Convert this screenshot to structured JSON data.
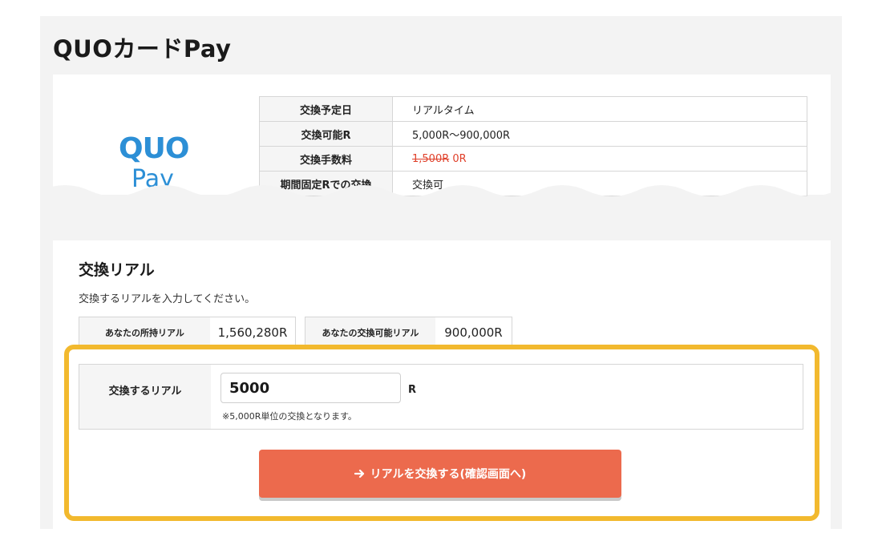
{
  "page": {
    "title": "QUOカードPay"
  },
  "logo": {
    "top_text": "QUO",
    "bottom_text": "Pay",
    "color": "#2c8fd6"
  },
  "info_table": {
    "rows": [
      {
        "label": "交換予定日",
        "value": "リアルタイム"
      },
      {
        "label": "交換可能R",
        "value": "5,000R～900,000R"
      },
      {
        "label": "交換手数料",
        "value_old": "1,500R",
        "value_new": "0R"
      },
      {
        "label": "期間固定Rでの交換",
        "value": "交換可"
      }
    ]
  },
  "exchange": {
    "section_title": "交換リアル",
    "instruction": "交換するリアルを入力してください。",
    "owned_label": "あなたの所持リアル",
    "owned_value": "1,560,280R",
    "exchangeable_label": "あなたの交換可能リアル",
    "exchangeable_value": "900,000R",
    "input_label": "交換するリアル",
    "input_value": "5000",
    "unit": "R",
    "note": "※5,000R単位の交換となります。",
    "submit_label": "リアルを交換する(確認画面へ)",
    "submit_icon": "arrow-right-icon"
  },
  "colors": {
    "highlight": "#f2b92e",
    "button": "#ec6a4d",
    "accent_red": "#e0402a"
  }
}
